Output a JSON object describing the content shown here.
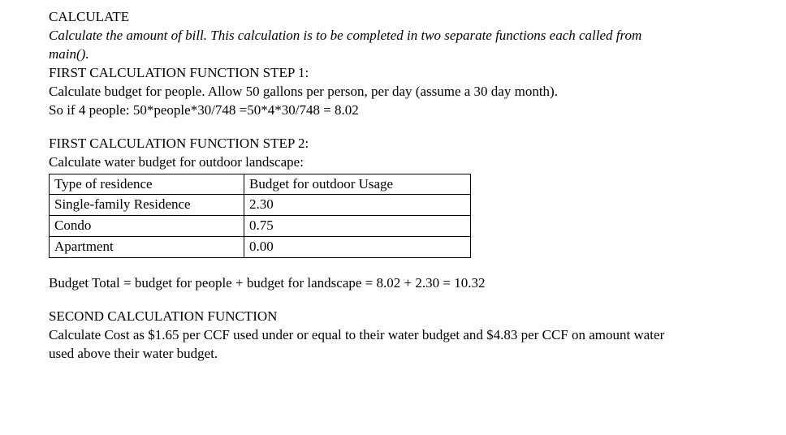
{
  "heading_calculate": "CALCULATE",
  "calc_intro": "Calculate the amount of bill. This calculation is to be completed in two separate functions each called from main().",
  "step1_heading": "FIRST CALCULATION FUNCTION STEP 1:",
  "step1_body": "Calculate budget for people. Allow 50 gallons per person, per day (assume a 30 day month).",
  "step1_formula": "So if 4 people: 50*people*30/748  =50*4*30/748 = 8.02",
  "step2_heading": "FIRST CALCULATION FUNCTION STEP 2:",
  "step2_body": "Calculate water budget for outdoor landscape:",
  "table": {
    "header": {
      "type": "Type of residence",
      "budget": "Budget for outdoor Usage"
    },
    "rows": [
      {
        "type": "Single-family Residence",
        "budget": "2.30"
      },
      {
        "type": "Condo",
        "budget": "0.75"
      },
      {
        "type": "Apartment",
        "budget": "0.00"
      }
    ]
  },
  "budget_total_line": "Budget Total = budget for people + budget for landscape = 8.02 + 2.30 = 10.32",
  "second_heading": "SECOND CALCULATION FUNCTION",
  "second_body": "Calculate Cost as $1.65 per CCF used under or equal to their water budget and $4.83 per CCF on amount water used above their water budget.",
  "chart_data": {
    "type": "table",
    "title": "Budget for outdoor Usage by Type of residence",
    "columns": [
      "Type of residence",
      "Budget for outdoor Usage"
    ],
    "rows": [
      [
        "Single-family Residence",
        2.3
      ],
      [
        "Condo",
        0.75
      ],
      [
        "Apartment",
        0.0
      ]
    ]
  }
}
